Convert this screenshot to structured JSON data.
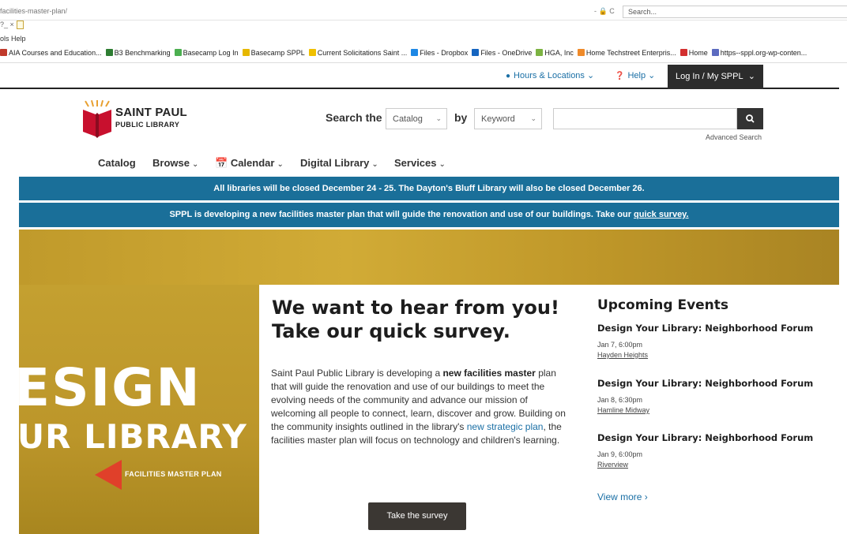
{
  "browser": {
    "url": "facilities-master-plan/",
    "tab_label": "?_ ×",
    "search_placeholder": "Search...",
    "reload_icons": "- 🔒 C",
    "menu": "ols  Help",
    "bookmarks": [
      {
        "label": "AIA Courses and Education...",
        "color": "#c0392b"
      },
      {
        "label": "B3 Benchmarking",
        "color": "#2e7d32"
      },
      {
        "label": "Basecamp Log In",
        "color": "#4caf50"
      },
      {
        "label": "Basecamp SPPL",
        "color": "#e6b800"
      },
      {
        "label": "Current Solicitations  Saint ...",
        "color": "#f0c000"
      },
      {
        "label": "Files - Dropbox",
        "color": "#1e88e5"
      },
      {
        "label": "Files - OneDrive",
        "color": "#1565c0"
      },
      {
        "label": "HGA, Inc",
        "color": "#7cb342"
      },
      {
        "label": "Home  Techstreet Enterpris...",
        "color": "#ef8a2a"
      },
      {
        "label": "Home",
        "color": "#d32f2f"
      },
      {
        "label": "https--sppl.org-wp-conten...",
        "color": "#5c6bc0"
      }
    ]
  },
  "utility": {
    "hours": "Hours & Locations",
    "help": "Help",
    "login": "Log In / My SPPL"
  },
  "header": {
    "logo_title": "SAINT PAUL",
    "logo_sub": "PUBLIC LIBRARY",
    "search_the": "Search the",
    "catalog_select": "Catalog",
    "by": "by",
    "keyword_select": "Keyword",
    "advanced": "Advanced Search"
  },
  "nav": {
    "catalog": "Catalog",
    "browse": "Browse",
    "calendar": "Calendar",
    "digital": "Digital Library",
    "services": "Services"
  },
  "alerts": {
    "closure": "All libraries will be closed December 24 - 25. The Dayton's Bluff Library will also be closed December 26.",
    "plan_text": "SPPL is developing a new facilities master plan that will guide the renovation and use of our buildings. Take our ",
    "plan_link": "quick survey."
  },
  "hero": {
    "big1": "ESIGN",
    "big2": "UR LIBRARY",
    "fmp": "FACILITIES MASTER PLAN",
    "headline1": "We want to hear from you!",
    "headline2": "Take our quick survey.",
    "body_1": "Saint Paul Public Library is developing a ",
    "body_bold": "new facilities master",
    "body_2": " plan that will guide the renovation and use of our buildings to meet the evolving needs of the community and advance our mission of welcoming all people to connect, learn, discover and grow. Building on the community insights outlined in the library's ",
    "body_link": "new strategic plan",
    "body_3": ", the facilities master plan will focus on technology and children's learning.",
    "survey_button": "Take the survey"
  },
  "events": {
    "title": "Upcoming Events",
    "items": [
      {
        "title": "Design Your Library: Neighborhood Forum",
        "date": "Jan 7, 6:00pm",
        "location": "Hayden Heights"
      },
      {
        "title": "Design Your Library: Neighborhood Forum",
        "date": "Jan 8, 6:30pm",
        "location": "Hamline Midway"
      },
      {
        "title": "Design Your Library: Neighborhood Forum",
        "date": "Jan 9, 6:00pm",
        "location": "Riverview"
      }
    ],
    "view_more": "View more ›"
  }
}
